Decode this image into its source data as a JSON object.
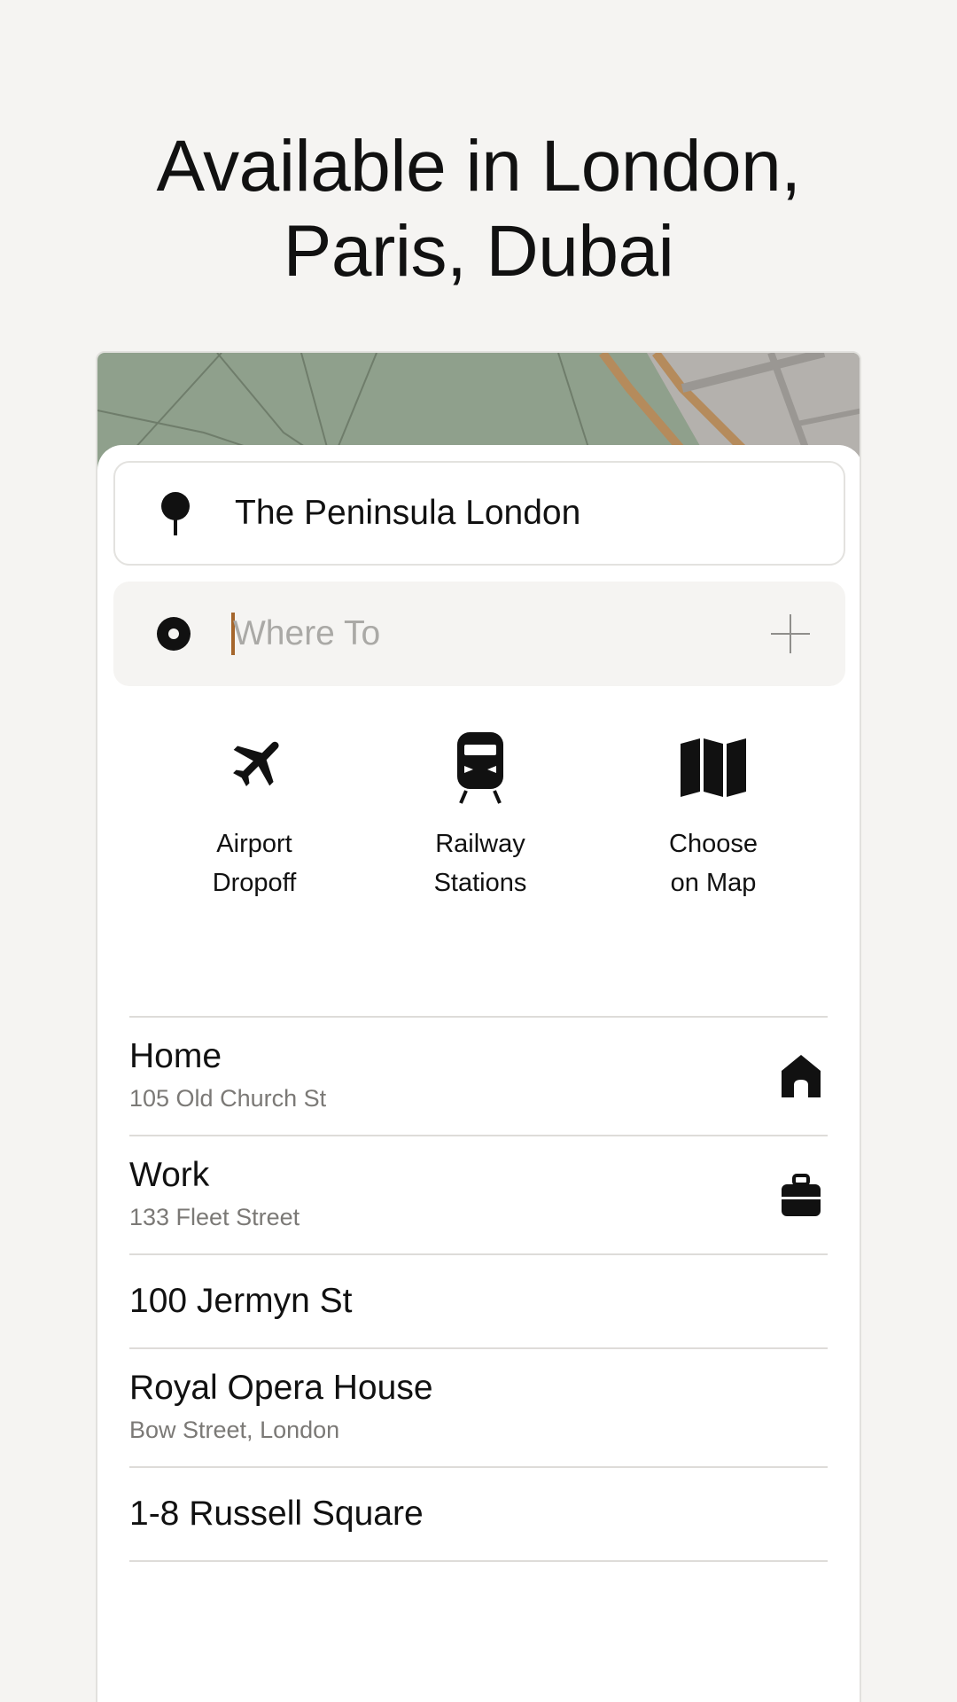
{
  "headline": {
    "line1": "Available in London,",
    "line2": "Paris, Dubai"
  },
  "pickup": {
    "icon": "pin-icon",
    "value": "The Peninsula London"
  },
  "destination": {
    "icon": "target-dot-icon",
    "placeholder": "Where To",
    "add_icon": "plus-icon"
  },
  "shortcuts": [
    {
      "icon": "airplane-icon",
      "line1": "Airport",
      "line2": "Dropoff"
    },
    {
      "icon": "train-icon",
      "line1": "Railway",
      "line2": "Stations"
    },
    {
      "icon": "map-icon",
      "line1": "Choose",
      "line2": "on Map"
    }
  ],
  "places": [
    {
      "title": "Home",
      "subtitle": "105 Old Church St",
      "icon": "house-icon"
    },
    {
      "title": "Work",
      "subtitle": "133 Fleet Street",
      "icon": "briefcase-icon"
    },
    {
      "title": "100 Jermyn St"
    },
    {
      "title": "Royal Opera House",
      "subtitle": "Bow Street, London"
    },
    {
      "title": "1-8 Russell Square"
    }
  ],
  "colors": {
    "background": "#f5f4f2",
    "map_green": "#8fa08c",
    "caret": "#a5662c",
    "road": "#b58b5c"
  }
}
